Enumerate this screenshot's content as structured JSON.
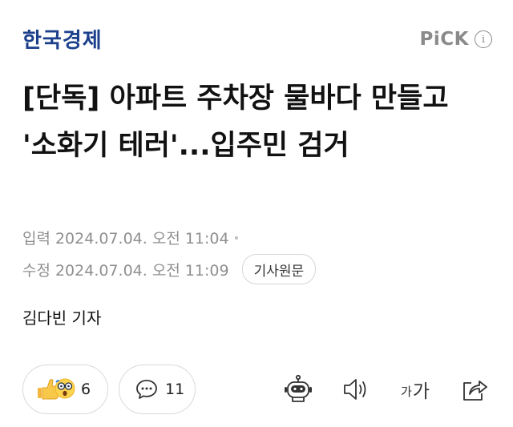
{
  "header": {
    "logo": "한국경제",
    "pick_label": "PiCK",
    "info_icon": "i"
  },
  "article": {
    "title": "[단독] 아파트 주차장 물바다 만들고 '소화기 테러'...입주민 검거",
    "input_label": "입력",
    "input_time": "2024.07.04. 오전 11:04",
    "modified_label": "수정",
    "modified_time": "2024.07.04. 오전 11:09",
    "original_button": "기사원문",
    "author": "김다빈 기자"
  },
  "actions": {
    "reactions_count": "6",
    "comments_count": "11",
    "font_small": "가",
    "font_big": "가"
  },
  "icons": {
    "info": "info-icon",
    "reaction": "thumbs-up-surprised-emoji-icon",
    "comment": "speech-bubble-icon",
    "bot": "robot-summary-icon",
    "sound": "speaker-icon",
    "font": "font-size-icon",
    "share": "share-icon"
  },
  "colors": {
    "logo": "#1b3f8b",
    "meta_text": "#8f8f8f",
    "border": "#d9d9d9"
  }
}
